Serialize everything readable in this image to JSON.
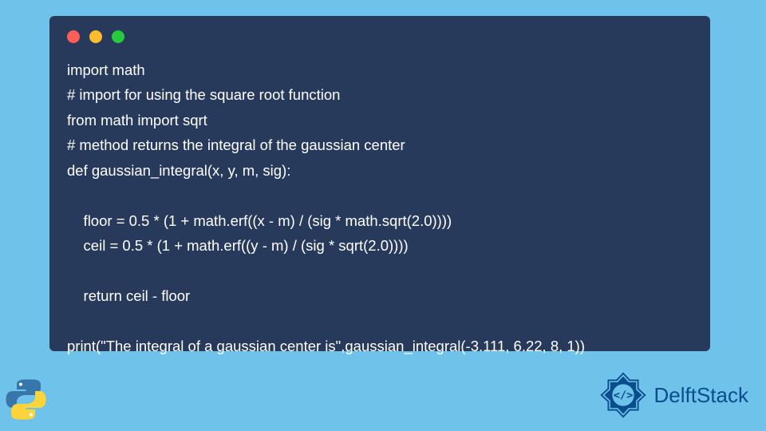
{
  "code": {
    "line1": "import math",
    "line2": "# import for using the square root function",
    "line3": "from math import sqrt",
    "line4": "# method returns the integral of the gaussian center",
    "line5": "def gaussian_integral(x, y, m, sig):",
    "line6": "",
    "line7": "    floor = 0.5 * (1 + math.erf((x - m) / (sig * math.sqrt(2.0))))",
    "line8": "    ceil = 0.5 * (1 + math.erf((y - m) / (sig * sqrt(2.0))))",
    "line9": "",
    "line10": "    return ceil - floor",
    "line11": "",
    "line12": "print(\"The integral of a gaussian center is\",gaussian_integral(-3.111, 6.22, 8, 1))"
  },
  "brand": {
    "name": "DelftStack"
  }
}
